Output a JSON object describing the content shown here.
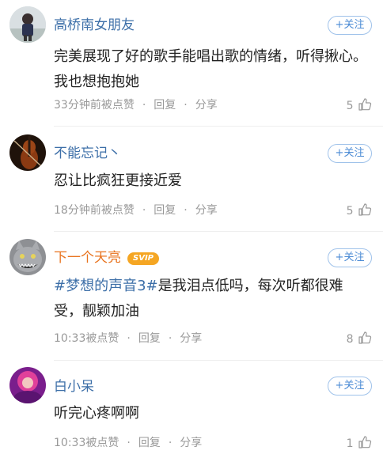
{
  "comments": [
    {
      "username": "高桥南女朋友",
      "follow_label": "+关注",
      "text": "完美展现了好的歌手能唱出歌的情绪，听得揪心。我也想抱抱她",
      "time": "33分钟前被点赞",
      "reply_label": "回复",
      "share_label": "分享",
      "likes": "5"
    },
    {
      "username": "不能忘记丶",
      "follow_label": "+关注",
      "text": "忍让比疯狂更接近爱",
      "time": "18分钟前被点赞",
      "reply_label": "回复",
      "share_label": "分享",
      "likes": "5"
    },
    {
      "username": "下一个天亮",
      "badge": "SVIP",
      "follow_label": "+关注",
      "hashtag": "#梦想的声音3#",
      "text": "是我泪点低吗，每次听都很难受，靓颖加油",
      "time": "10:33被点赞",
      "reply_label": "回复",
      "share_label": "分享",
      "likes": "8"
    },
    {
      "username": "白小呆",
      "follow_label": "+关注",
      "text": "听完心疼啊啊",
      "time": "10:33被点赞",
      "reply_label": "回复",
      "share_label": "分享",
      "likes": "1"
    }
  ],
  "colors": {
    "username_blue": "#3d6fa8",
    "username_orange": "#e8731e",
    "follow_border": "#9fc2ea",
    "meta_gray": "#999999"
  }
}
